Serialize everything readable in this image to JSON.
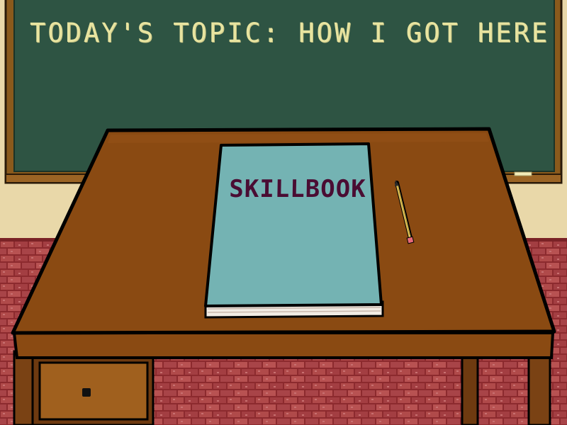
{
  "chalkboard": {
    "text": "TODAY'S TOPIC: HOW I GOT HERE"
  },
  "book": {
    "title": "SKILLBOOK"
  },
  "colors": {
    "wall": "#e9d8a9",
    "chalkboard": "#2e5443",
    "chalkboard_frame": "#8a5a1c",
    "chalk": "#e8e4a0",
    "brick": "#8c2a2e",
    "desk_top": "#8a4a12",
    "desk_front": "#7a3f10",
    "book_cover": "#74b3b3",
    "book_title": "#4a0d33",
    "pencil": "#e3c55a",
    "eraser": "#e86a7a"
  },
  "icons": [
    "pencil-icon",
    "drawer-knob-icon"
  ]
}
